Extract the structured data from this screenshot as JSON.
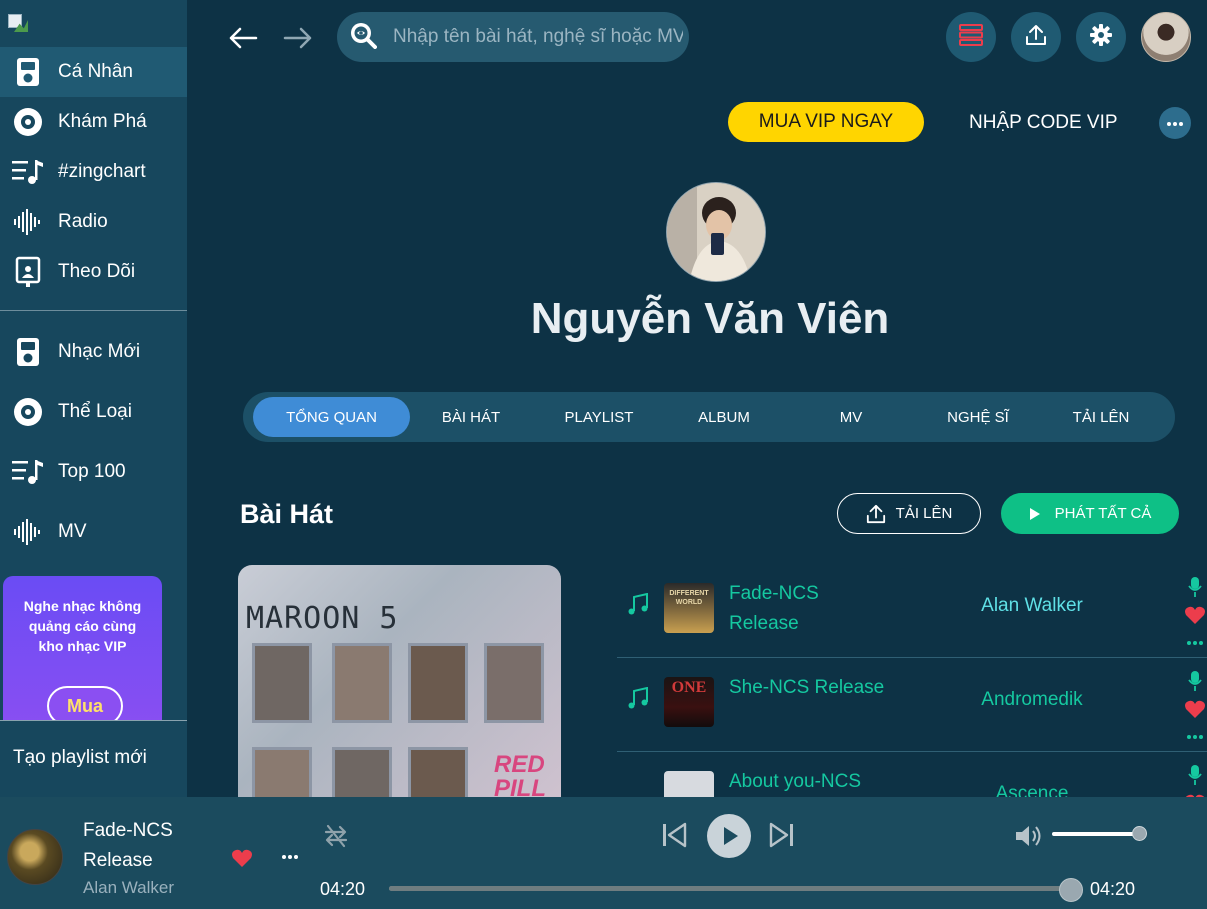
{
  "sidebar": {
    "items": [
      {
        "label": "Cá Nhân",
        "icon": "ipod-icon",
        "active": true
      },
      {
        "label": "Khám Phá",
        "icon": "disc-icon",
        "active": false
      },
      {
        "label": "#zingchart",
        "icon": "playlist-icon",
        "active": false
      },
      {
        "label": "Radio",
        "icon": "soundwave-icon",
        "active": false
      },
      {
        "label": "Theo Dõi",
        "icon": "follow-icon",
        "active": false
      }
    ],
    "items2": [
      {
        "label": "Nhạc Mới",
        "icon": "ipod-icon"
      },
      {
        "label": "Thể Loại",
        "icon": "disc-icon"
      },
      {
        "label": "Top 100",
        "icon": "playlist-icon"
      },
      {
        "label": "MV",
        "icon": "soundwave-icon"
      }
    ],
    "vip_promo": {
      "text": "Nghe nhạc không quảng cáo cùng kho nhạc VIP",
      "button": "Mua"
    },
    "new_playlist": "Tạo playlist mới"
  },
  "header": {
    "search_placeholder": "Nhập tên bài hát, nghệ sĩ hoặc MV..."
  },
  "vip": {
    "buy_label": "MUA VIP NGAY",
    "code_label": "NHẬP CODE VIP"
  },
  "profile": {
    "name": "Nguyễn Văn Viên"
  },
  "tabs": [
    "TỔNG QUAN",
    "BÀI HÁT",
    "PLAYLIST",
    "ALBUM",
    "MV",
    "NGHỆ SĨ",
    "TẢI LÊN"
  ],
  "songs_section": {
    "title": "Bài Hát",
    "upload_label": "TẢI LÊN",
    "play_all_label": "PHÁT TẤT CẢ",
    "album_art": {
      "band": "MAROON 5",
      "label": "RED PILL"
    },
    "songs": [
      {
        "title": "Fade-NCS Release",
        "artist": "Alan Walker",
        "thumb_text": "DIFFERENT WORLD"
      },
      {
        "title": "She-NCS Release",
        "artist": "Andromedik",
        "thumb_text": "ONE"
      },
      {
        "title": "About you-NCS",
        "artist": "Ascence",
        "thumb_text": ""
      }
    ]
  },
  "player": {
    "title": "Fade-NCS Release",
    "artist": "Alan Walker",
    "current_time": "04:20",
    "total_time": "04:20",
    "progress": 1.0,
    "volume": 1.0
  },
  "colors": {
    "accent": "#15c8a0",
    "vip_yellow": "#ffd500",
    "tab_active": "#3f8cd6",
    "play_all": "#0ec086",
    "heart": "#ec3d4c"
  }
}
